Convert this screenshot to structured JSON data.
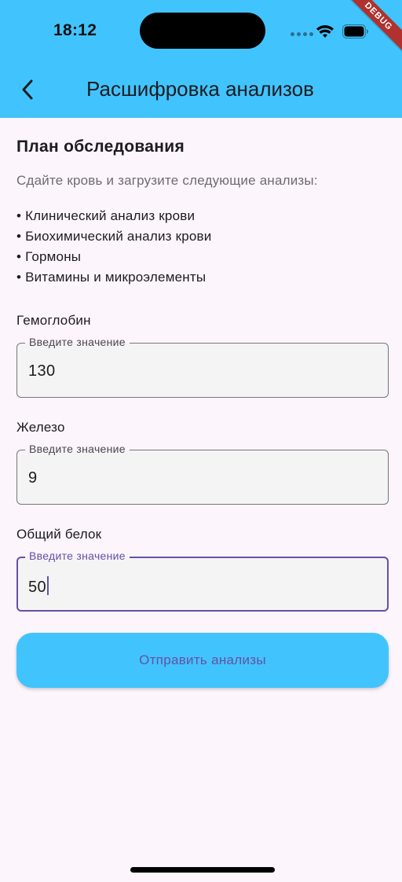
{
  "status_bar": {
    "time": "18:12",
    "debug_label": "DEBUG"
  },
  "app_bar": {
    "title": "Расшифровка анализов",
    "background": "#41C4FE"
  },
  "plan": {
    "title": "План обследования",
    "subtitle": "Сдайте кровь и загрузите следующие анализы:",
    "items": [
      "• Клинический анализ крови",
      "• Биохимический анализ крови",
      "• Гормоны",
      "• Витамины и микроэлементы"
    ]
  },
  "fields": [
    {
      "label": "Гемоглобин",
      "placeholder": "Введите значение",
      "value": "130",
      "focused": false
    },
    {
      "label": "Железо",
      "placeholder": "Введите значение",
      "value": "9",
      "focused": false
    },
    {
      "label": "Общий белок",
      "placeholder": "Введите значение",
      "value": "50",
      "focused": true
    }
  ],
  "submit": {
    "label": "Отправить анализы",
    "background": "#41C4FE",
    "text_color": "#6750A4"
  },
  "icons": {
    "back": "arrow-back-icon",
    "wifi": "wifi-icon",
    "battery": "battery-icon",
    "signal": "cellular-signal-icon"
  }
}
